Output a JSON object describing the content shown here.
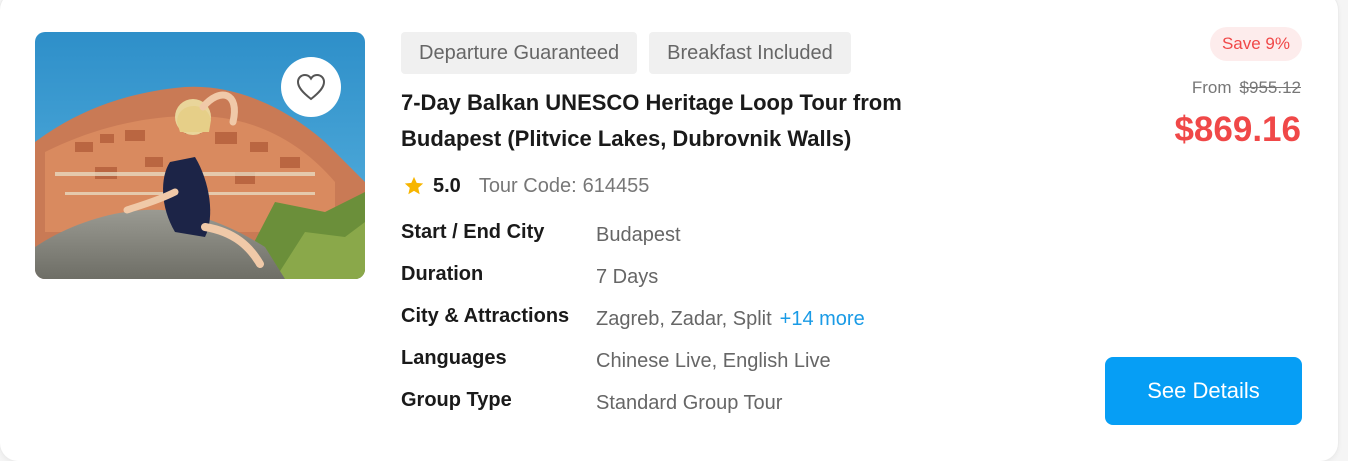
{
  "tour": {
    "tags": [
      "Departure Guaranteed",
      "Breakfast Included"
    ],
    "title": "7-Day Balkan UNESCO Heritage Loop Tour from Budapest (Plitvice Lakes, Dubrovnik Walls)",
    "rating": "5.0",
    "tour_code_label": "Tour Code:",
    "tour_code": "614455",
    "details": [
      {
        "label": "Start / End City",
        "value": "Budapest"
      },
      {
        "label": "Duration",
        "value": "7 Days"
      },
      {
        "label": "City & Attractions",
        "value": "Zagreb, Zadar, Split",
        "more": "+14 more"
      },
      {
        "label": "Languages",
        "value": "Chinese Live, English Live"
      },
      {
        "label": "Group Type",
        "value": "Standard Group Tour"
      }
    ]
  },
  "pricing": {
    "save": "Save 9%",
    "from_label": "From",
    "original_price": "$955.12",
    "price": "$869.16"
  },
  "actions": {
    "see_details": "See Details"
  },
  "icons": {
    "favorite": "heart-outline-icon",
    "rating": "star-icon"
  },
  "colors": {
    "accent": "#069ef5",
    "price": "#f04848",
    "star": "#f7b500",
    "link": "#1a9be6"
  }
}
